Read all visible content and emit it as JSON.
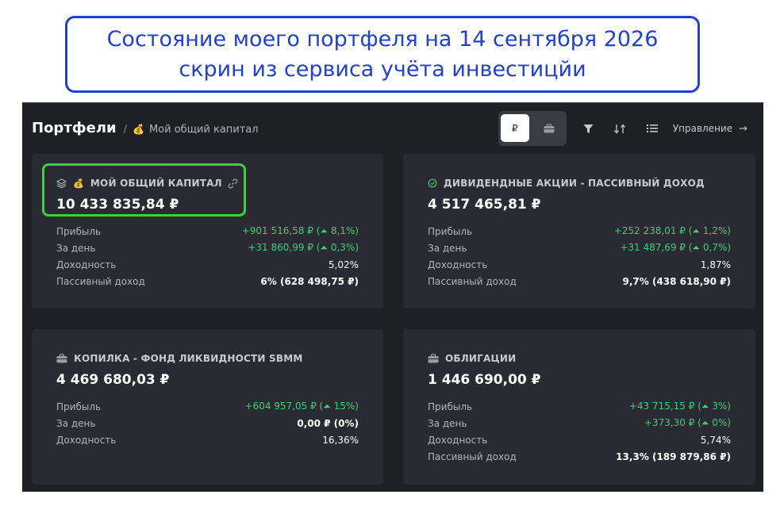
{
  "caption": {
    "line1": "Состояние моего портфеля на 14 сентября 2026",
    "line2": "скрин из сервиса учёта инвестицйи"
  },
  "header": {
    "title": "Портфели",
    "separator": "/",
    "current": "Мой общий капитал",
    "currency_label": "₽",
    "manage_label": "Управление",
    "manage_arrow": "→"
  },
  "icons": {
    "money_bag": "💰",
    "filter": "filter-icon",
    "sort": "sort-icon",
    "list": "list-icon",
    "briefcase": "briefcase-icon",
    "layers": "layers-icon",
    "link": "link-icon",
    "check": "check-circle-icon"
  },
  "colors": {
    "positive": "#3ecf7a",
    "card_bg": "#2a2a33",
    "app_bg": "#1f1f26",
    "caption_blue": "#1f3fd6",
    "highlight_green": "#38d33a"
  },
  "cards": [
    {
      "title": "МОЙ ОБЩИЙ КАПИТАЛ",
      "value": "10 433 835,84 ₽",
      "rows": [
        {
          "label": "Прибыль",
          "value": "+901 516,58 ₽ (⏶ 8,1%)"
        },
        {
          "label": "За день",
          "value": "+31 860,99 ₽ (⏶ 0,3%)"
        },
        {
          "label": "Доходность",
          "value": "5,02%"
        },
        {
          "label": "Пассивный доход",
          "value": "6% (628 498,75 ₽)"
        }
      ]
    },
    {
      "title": "ДИВИДЕНДНЫЕ АКЦИИ - ПАССИВНЫЙ ДОХОД",
      "value": "4 517 465,81 ₽",
      "rows": [
        {
          "label": "Прибыль",
          "value": "+252 238,01 ₽ (⏶ 1,2%)"
        },
        {
          "label": "За день",
          "value": "+31 487,69 ₽ (⏶ 0,7%)"
        },
        {
          "label": "Доходность",
          "value": "1,87%"
        },
        {
          "label": "Пассивный доход",
          "value": "9,7% (438 618,90 ₽)"
        }
      ]
    },
    {
      "title": "КОПИЛКА - ФОНД ЛИКВИДНОСТИ SBMM",
      "value": "4 469 680,03 ₽",
      "rows": [
        {
          "label": "Прибыль",
          "value": "+604 957,05 ₽ (⏶ 15%)"
        },
        {
          "label": "За день",
          "value": "0,00 ₽ (0%)"
        },
        {
          "label": "Доходность",
          "value": "16,36%"
        }
      ]
    },
    {
      "title": "ОБЛИГАЦИИ",
      "value": "1 446 690,00 ₽",
      "rows": [
        {
          "label": "Прибыль",
          "value": "+43 715,15 ₽ (⏶ 3%)"
        },
        {
          "label": "За день",
          "value": "+373,30 ₽ (⏶ 0%)"
        },
        {
          "label": "Доходность",
          "value": "5,74%"
        },
        {
          "label": "Пассивный доход",
          "value": "13,3% (189 879,86 ₽)"
        }
      ]
    }
  ]
}
